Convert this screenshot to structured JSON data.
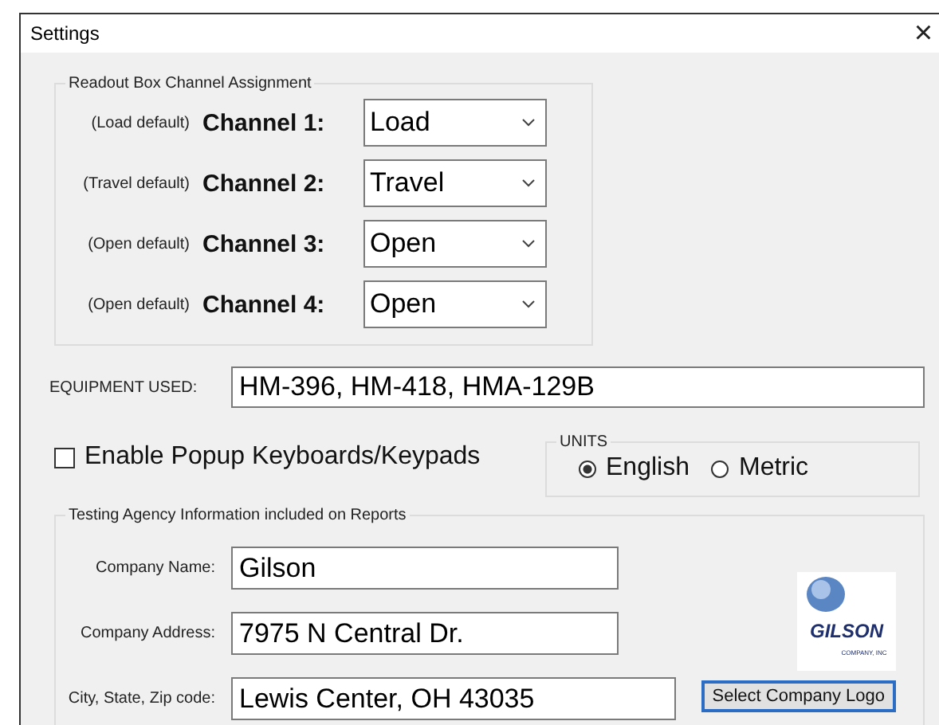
{
  "window": {
    "title": "Settings",
    "close": "×"
  },
  "channel_group": {
    "legend": "Readout Box Channel Assignment",
    "channels": [
      {
        "hint": "(Load default)",
        "label": "Channel 1:",
        "value": "Load"
      },
      {
        "hint": "(Travel default)",
        "label": "Channel 2:",
        "value": "Travel"
      },
      {
        "hint": "(Open default)",
        "label": "Channel 3:",
        "value": "Open"
      },
      {
        "hint": "(Open default)",
        "label": "Channel 4:",
        "value": "Open"
      }
    ]
  },
  "equipment": {
    "label": "EQUIPMENT USED:",
    "value": "HM-396, HM-418, HMA-129B"
  },
  "popup_keyboards": {
    "label": "Enable Popup Keyboards/Keypads",
    "checked": false
  },
  "units": {
    "legend": "UNITS",
    "options": [
      {
        "label": "English",
        "selected": true
      },
      {
        "label": "Metric",
        "selected": false
      }
    ]
  },
  "agency_group": {
    "legend": "Testing Agency Information included on Reports",
    "fields": [
      {
        "label": "Company Name:",
        "value": "Gilson"
      },
      {
        "label": "Company Address:",
        "value": "7975 N Central Dr."
      },
      {
        "label": "City, State, Zip code:",
        "value": "Lewis Center, OH 43035"
      }
    ],
    "logo": {
      "wordmark": "GILSON",
      "subtitle": "COMPANY, INC"
    },
    "logo_button": "Select Company Logo"
  }
}
